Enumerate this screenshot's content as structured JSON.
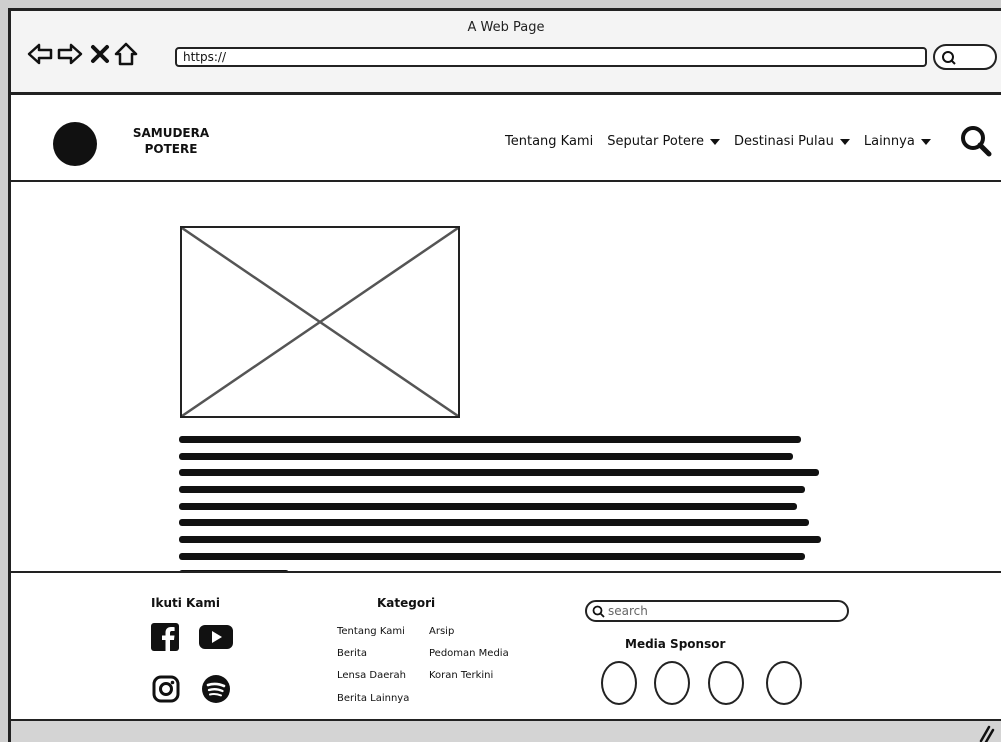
{
  "window": {
    "title": "A Web Page"
  },
  "browser": {
    "url": "https://",
    "buttons": [
      "back-arrow-icon",
      "forward-arrow-icon",
      "stop-icon",
      "home-icon"
    ]
  },
  "header": {
    "brand_line1": "SAMUDERA",
    "brand_line2": "POTERE",
    "nav": [
      {
        "label": "Tentang Kami",
        "dropdown": false
      },
      {
        "label": "Seputar Potere",
        "dropdown": true
      },
      {
        "label": "Destinasi Pulau",
        "dropdown": true
      },
      {
        "label": "Lainnya",
        "dropdown": true
      }
    ]
  },
  "main": {
    "image": "image-placeholder",
    "article_lines": 9
  },
  "footer": {
    "follow_title": "Ikuti Kami",
    "social_icons": [
      "facebook-icon",
      "youtube-icon",
      "instagram-icon",
      "spotify-icon"
    ],
    "category_title": "Kategori",
    "categories_col1": [
      "Tentang Kami",
      "Berita",
      "Lensa Daerah",
      "Berita Lainnya"
    ],
    "categories_col2": [
      "Arsip",
      "Pedoman Media",
      "Koran Terkini"
    ],
    "search_placeholder": "search",
    "sponsor_title": "Media Sponsor",
    "sponsor_count": 4
  },
  "colors": {
    "ink": "#111111",
    "chrome": "#f4f4f4",
    "status": "#d4d4d4"
  }
}
